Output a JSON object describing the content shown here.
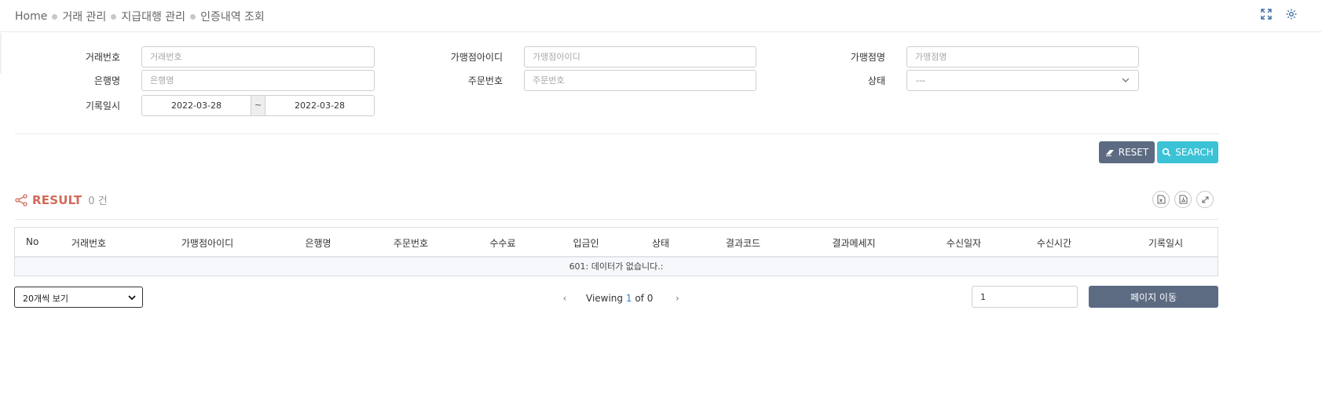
{
  "breadcrumb": [
    "Home",
    "거래 관리",
    "지급대행 관리",
    "인증내역 조회"
  ],
  "top_icons": [
    "expand-icon",
    "gear-icon"
  ],
  "form": {
    "tx_no": {
      "label": "거래번호",
      "placeholder": "거래번호"
    },
    "merchant_id": {
      "label": "가맹점아이디",
      "placeholder": "가맹점아이디"
    },
    "merchant_name": {
      "label": "가맹점명",
      "placeholder": "가맹점명"
    },
    "bank": {
      "label": "은행명",
      "placeholder": "은행명"
    },
    "order_no": {
      "label": "주문번호",
      "placeholder": "주문번호"
    },
    "status": {
      "label": "상태",
      "value": "---"
    },
    "record_date": {
      "label": "기록일시",
      "from": "2022-03-28",
      "sep": "~",
      "to": "2022-03-28"
    }
  },
  "buttons": {
    "reset": "RESET",
    "search": "SEARCH"
  },
  "result": {
    "title": "RESULT",
    "count": "0 건",
    "icons": [
      "excel-icon",
      "pdf-icon",
      "fullscreen-icon"
    ]
  },
  "table": {
    "columns": [
      "No",
      "거래번호",
      "가맹점아이디",
      "은행명",
      "주문번호",
      "수수료",
      "입금인",
      "상태",
      "결과코드",
      "결과메세지",
      "수신일자",
      "수신시간",
      "기록일시"
    ],
    "empty_message": "601: 데이터가 없습니다.:"
  },
  "pager": {
    "page_size": "20개씩 보기",
    "viewing": "Viewing",
    "current": "1",
    "of_total": "of 0",
    "goto_value": "1",
    "goto_label": "페이지 이동"
  }
}
